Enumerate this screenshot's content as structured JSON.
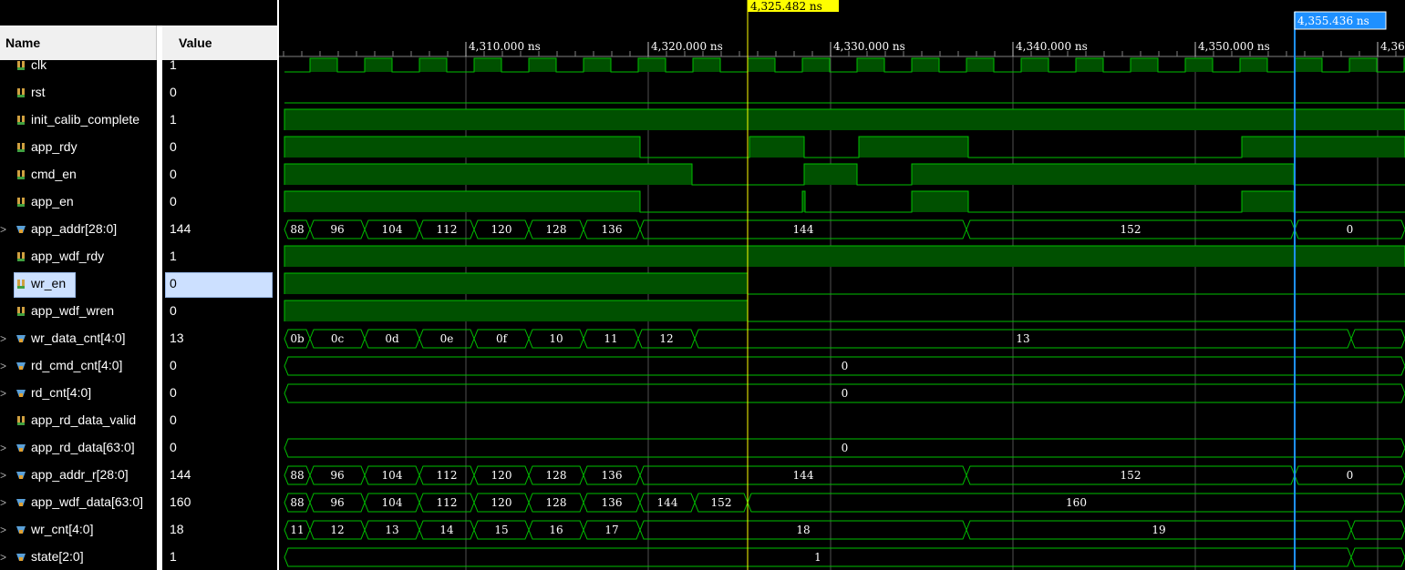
{
  "header": {
    "name_col": "Name",
    "value_col": "Value"
  },
  "colors": {
    "wave": "#00c000",
    "wave_fill": "#005000",
    "cursor_yellow": "#ffff00",
    "cursor_blue": "#1e90ff",
    "grid": "#505050"
  },
  "timeline": {
    "ticks": [
      "4,310.000 ns",
      "4,320.000 ns",
      "4,330.000 ns",
      "4,340.000 ns",
      "4,350.000 ns",
      "4,36"
    ],
    "cursor_main": "4,325.482 ns",
    "cursor_second": "4,355.436 ns"
  },
  "signals": [
    {
      "name": "clk",
      "value": "1",
      "icon": "bit-signal-icon",
      "bus": false
    },
    {
      "name": "rst",
      "value": "0",
      "icon": "bit-signal-icon",
      "bus": false
    },
    {
      "name": "init_calib_complete",
      "value": "1",
      "icon": "bit-signal-icon",
      "bus": false
    },
    {
      "name": "app_rdy",
      "value": "0",
      "icon": "bit-signal-icon",
      "bus": false
    },
    {
      "name": "cmd_en",
      "value": "0",
      "icon": "bit-signal-icon",
      "bus": false
    },
    {
      "name": "app_en",
      "value": "0",
      "icon": "bit-signal-icon",
      "bus": false
    },
    {
      "name": "app_addr[28:0]",
      "value": "144",
      "icon": "bus-signal-icon",
      "bus": true
    },
    {
      "name": "app_wdf_rdy",
      "value": "1",
      "icon": "bit-signal-icon",
      "bus": false
    },
    {
      "name": "wr_en",
      "value": "0",
      "icon": "bit-signal-icon",
      "bus": false,
      "selected": true
    },
    {
      "name": "app_wdf_wren",
      "value": "0",
      "icon": "bit-signal-icon",
      "bus": false
    },
    {
      "name": "wr_data_cnt[4:0]",
      "value": "13",
      "icon": "bus-signal-icon",
      "bus": true
    },
    {
      "name": "rd_cmd_cnt[4:0]",
      "value": "0",
      "icon": "bus-signal-icon",
      "bus": true
    },
    {
      "name": "rd_cnt[4:0]",
      "value": "0",
      "icon": "bus-signal-icon",
      "bus": true
    },
    {
      "name": "app_rd_data_valid",
      "value": "0",
      "icon": "bit-signal-icon",
      "bus": false
    },
    {
      "name": "app_rd_data[63:0]",
      "value": "0",
      "icon": "bus-signal-icon",
      "bus": true
    },
    {
      "name": "app_addr_r[28:0]",
      "value": "144",
      "icon": "bus-signal-icon",
      "bus": true
    },
    {
      "name": "app_wdf_data[63:0]",
      "value": "160",
      "icon": "bus-signal-icon",
      "bus": true
    },
    {
      "name": "wr_cnt[4:0]",
      "value": "18",
      "icon": "bus-signal-icon",
      "bus": true
    },
    {
      "name": "state[2:0]",
      "value": "1",
      "icon": "bus-signal-icon",
      "bus": true
    }
  ],
  "waves": {
    "init_calib_complete": [
      [
        "hi",
        0,
        1235
      ]
    ],
    "app_rdy": [
      [
        "hi",
        0,
        396
      ],
      [
        "hi",
        516,
        576
      ],
      [
        "hi",
        636,
        756
      ],
      [
        "hi",
        1056,
        1235
      ]
    ],
    "cmd_en": [
      [
        "hi",
        0,
        453
      ],
      [
        "hi",
        576,
        634
      ],
      [
        "hi",
        694,
        1113
      ]
    ],
    "app_en": [
      [
        "hi",
        0,
        396
      ],
      [
        "hi",
        574,
        577
      ],
      [
        "hi",
        694,
        756
      ],
      [
        "hi",
        1056,
        1113
      ]
    ],
    "app_wdf_rdy": [
      [
        "hi",
        0,
        1235
      ]
    ],
    "wr_en": [
      [
        "hi",
        0,
        514
      ]
    ],
    "app_wdf_wren": [
      [
        "hi",
        0,
        514
      ]
    ]
  },
  "buses": {
    "app_addr": [
      [
        "88",
        6,
        34
      ],
      [
        "96",
        34,
        94
      ],
      [
        "104",
        94,
        154
      ],
      [
        "112",
        154,
        214
      ],
      [
        "120",
        214,
        274
      ],
      [
        "128",
        274,
        334
      ],
      [
        "136",
        334,
        396
      ],
      [
        "144",
        396,
        754
      ],
      [
        "152",
        754,
        1114
      ],
      [
        "0",
        1114,
        1235
      ]
    ],
    "wr_data_cnt": [
      [
        "0b",
        6,
        34
      ],
      [
        "0c",
        34,
        94
      ],
      [
        "0d",
        94,
        154
      ],
      [
        "0e",
        154,
        214
      ],
      [
        "0f",
        214,
        274
      ],
      [
        "10",
        274,
        334
      ],
      [
        "11",
        334,
        394
      ],
      [
        "12",
        394,
        456
      ],
      [
        "13",
        456,
        1176
      ],
      [
        "",
        1176,
        1235
      ]
    ],
    "rd_cmd_cnt": [
      [
        "0",
        6,
        1235
      ]
    ],
    "rd_cnt": [
      [
        "0",
        6,
        1235
      ]
    ],
    "app_rd_data": [
      [
        "0",
        6,
        1235
      ]
    ],
    "app_addr_r": [
      [
        "88",
        6,
        34
      ],
      [
        "96",
        34,
        94
      ],
      [
        "104",
        94,
        154
      ],
      [
        "112",
        154,
        214
      ],
      [
        "120",
        214,
        274
      ],
      [
        "128",
        274,
        334
      ],
      [
        "136",
        334,
        396
      ],
      [
        "144",
        396,
        754
      ],
      [
        "152",
        754,
        1114
      ],
      [
        "0",
        1114,
        1235
      ]
    ],
    "app_wdf_data": [
      [
        "88",
        6,
        34
      ],
      [
        "96",
        34,
        94
      ],
      [
        "104",
        94,
        154
      ],
      [
        "112",
        154,
        214
      ],
      [
        "120",
        214,
        274
      ],
      [
        "128",
        274,
        334
      ],
      [
        "136",
        334,
        396
      ],
      [
        "144",
        396,
        456
      ],
      [
        "152",
        456,
        514
      ],
      [
        "160",
        514,
        1235
      ]
    ],
    "wr_cnt": [
      [
        "11",
        6,
        34
      ],
      [
        "12",
        34,
        94
      ],
      [
        "13",
        94,
        154
      ],
      [
        "14",
        154,
        214
      ],
      [
        "15",
        214,
        274
      ],
      [
        "16",
        274,
        334
      ],
      [
        "17",
        334,
        396
      ],
      [
        "18",
        396,
        754
      ],
      [
        "19",
        754,
        1176
      ],
      [
        "",
        1176,
        1235
      ]
    ],
    "state": [
      [
        "1",
        6,
        1176
      ],
      [
        "",
        1176,
        1235
      ]
    ]
  }
}
